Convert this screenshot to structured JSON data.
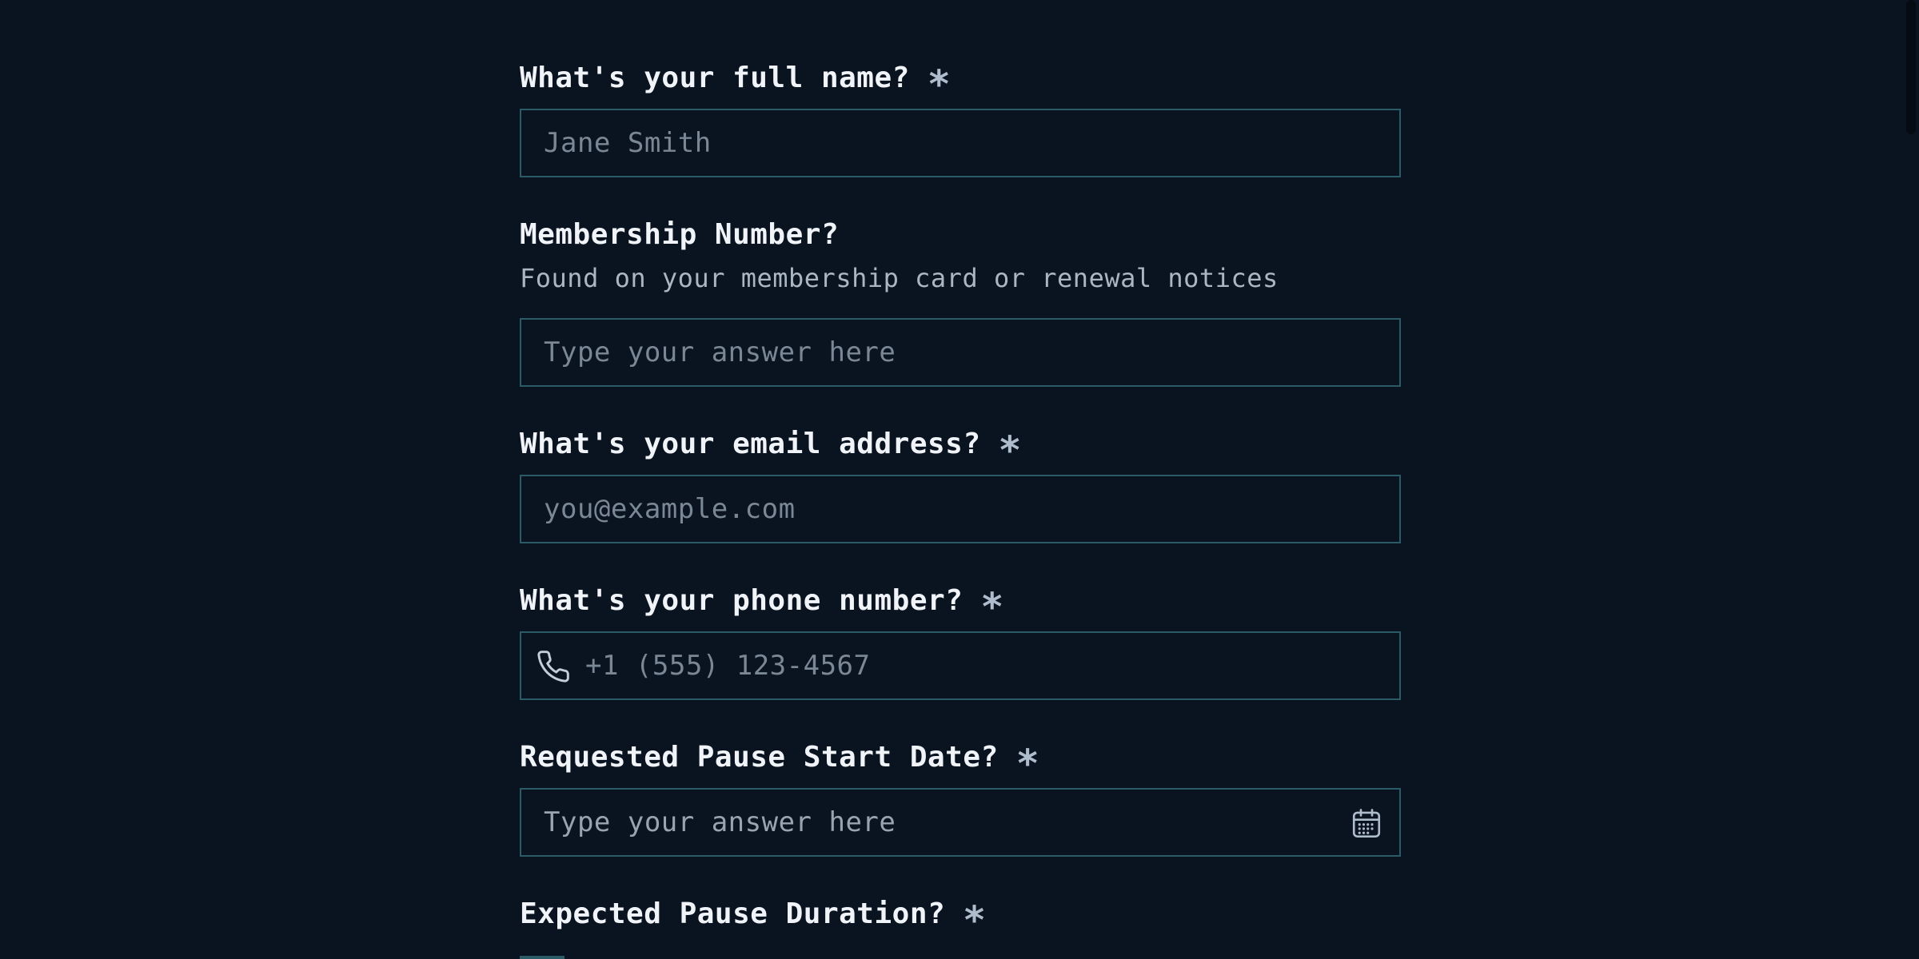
{
  "form": {
    "full_name": {
      "label": "What's your full name?",
      "required_mark": "*",
      "placeholder": "Jane Smith"
    },
    "membership": {
      "label": "Membership Number?",
      "description": "Found on your membership card or renewal notices",
      "placeholder": "Type your answer here"
    },
    "email": {
      "label": "What's your email address?",
      "required_mark": "*",
      "placeholder": "you@example.com"
    },
    "phone": {
      "label": "What's your phone number?",
      "required_mark": "*",
      "placeholder": "+1 (555) 123-4567",
      "icon": "phone-icon"
    },
    "pause_start": {
      "label": "Requested Pause Start Date?",
      "required_mark": "*",
      "placeholder": "Type your answer here",
      "icon": "calendar-icon"
    },
    "pause_duration": {
      "label": "Expected Pause Duration?",
      "required_mark": "*"
    }
  },
  "colors": {
    "background": "#0a1420",
    "input_border": "#2a5b66",
    "label_text": "#f0f4f8",
    "placeholder_text": "#7a8794"
  }
}
